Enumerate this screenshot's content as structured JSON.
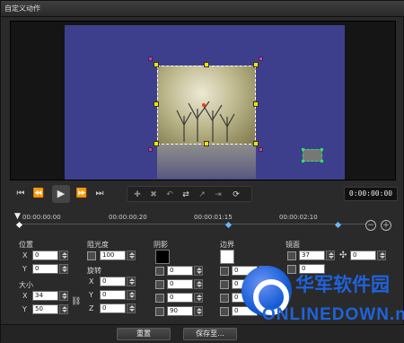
{
  "window": {
    "title": "自定义动作"
  },
  "preview": {
    "colors": {
      "stage": "#3e3f8c",
      "handle": "#f1e500",
      "rotate_handle": "#d230d8",
      "pip_handle": "#2ee06a"
    },
    "icons": [
      "move-handle",
      "rotate-handle"
    ]
  },
  "transport": {
    "buttons": [
      "jump-start",
      "prev-frame",
      "play",
      "next-frame",
      "jump-end"
    ],
    "timecode": "0:00:00:00"
  },
  "timeline": {
    "ticks": [
      "00:00:00:00",
      "00:00:00:20",
      "00:00:01:15",
      "00:00:02:10"
    ],
    "keyframe_color": "#68b7ff"
  },
  "panel": {
    "position": {
      "label": "位置",
      "x": "0",
      "y": "0"
    },
    "size": {
      "label": "大小",
      "x": "34",
      "y": "50"
    },
    "opacity": {
      "label": "阻光度",
      "value": "100"
    },
    "rotation": {
      "label": "旋转",
      "x": "0",
      "y": "0",
      "z": "0"
    },
    "shadow": {
      "label": "阴影",
      "fields": [
        "0",
        "0",
        "0",
        "90"
      ]
    },
    "border": {
      "label": "边界",
      "fields": [
        "0",
        "0",
        "0",
        "0"
      ]
    },
    "mirror": {
      "label": "镜面",
      "fields": [
        "37",
        "0",
        "0"
      ]
    }
  },
  "footer": {
    "reset": "重置",
    "save": "保存至..."
  },
  "watermark": {
    "line1": "华军软件园",
    "line2": "ONLINEDOWN.net"
  }
}
